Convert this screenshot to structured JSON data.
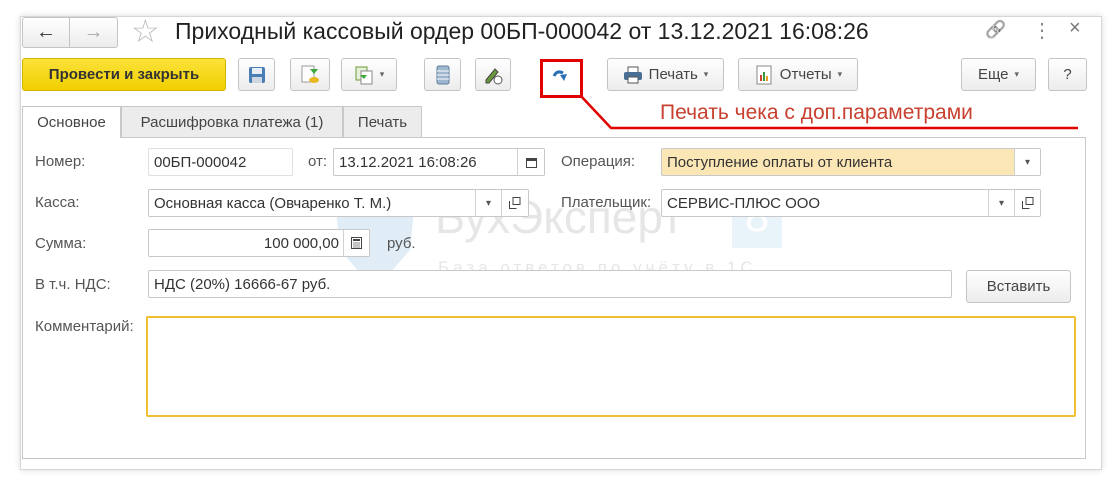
{
  "window": {
    "title": "Приходный кассовый ордер 00БП-000042 от 13.12.2021 16:08:26",
    "back": "←",
    "forward": "→",
    "star": "☆",
    "link": "🔗",
    "more": "⋮",
    "close": "×"
  },
  "toolbar": {
    "post_close": "Провести и закрыть",
    "print": "Печать",
    "reports": "Отчеты",
    "more": "Еще",
    "help": "?",
    "dropdown": "▾"
  },
  "annotation": {
    "text": "Печать чека с доп.параметрами",
    "color": "#e00000"
  },
  "tabs": [
    {
      "label": "Основное"
    },
    {
      "label": "Расшифровка платежа (1)"
    },
    {
      "label": "Печать"
    }
  ],
  "form": {
    "number_label": "Номер:",
    "number": "00БП-000042",
    "date_label": "от:",
    "date": "13.12.2021 16:08:26",
    "operation_label": "Операция:",
    "operation": "Поступление оплаты от клиента",
    "cash_label": "Касса:",
    "cash": "Основная касса (Овчаренко Т. М.)",
    "payer_label": "Плательщик:",
    "payer": "СЕРВИС-ПЛЮС ООО",
    "sum_label": "Сумма:",
    "sum": "100 000,00",
    "currency": "руб.",
    "vat_label": "В т.ч. НДС:",
    "vat": "НДС (20%) 16666-67 руб.",
    "insert": "Вставить",
    "comment_label": "Комментарий:",
    "comment": ""
  },
  "watermark": {
    "brand": "БухЭксперт",
    "num": "8",
    "tagline": "База ответов по учёту в 1С"
  },
  "colors": {
    "primary": "#f5d800",
    "operation_bg": "#fbe6b5",
    "comment_border": "#f0c030"
  }
}
